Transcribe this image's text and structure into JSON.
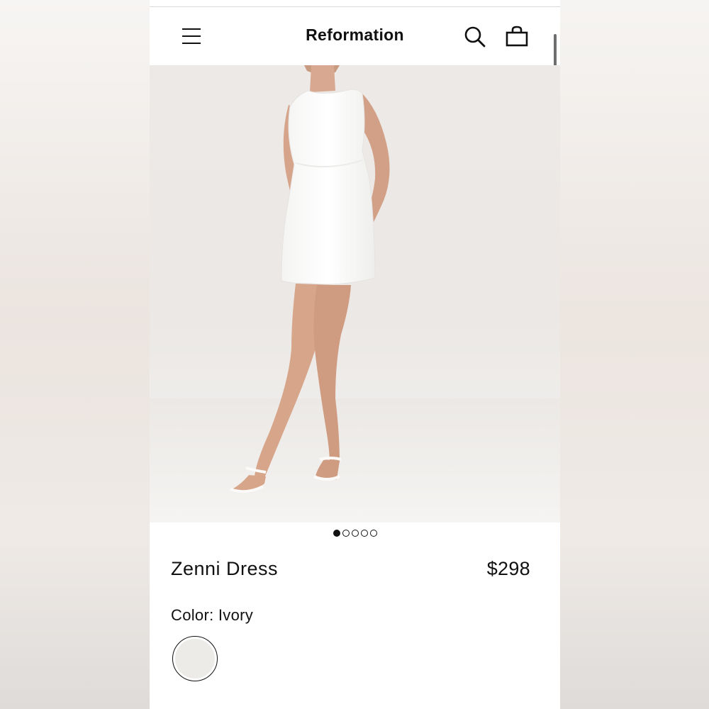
{
  "header": {
    "brand": "Reformation",
    "menu_icon": "hamburger-menu-icon",
    "search_icon": "search-icon",
    "bag_icon": "shopping-bag-icon"
  },
  "hero": {
    "image_count": 5,
    "active_index": 0
  },
  "product": {
    "name": "Zenni Dress",
    "price": "$298",
    "color_label": "Color: Ivory",
    "swatch_color": "#ecebe7"
  },
  "colors": {
    "text": "#111111",
    "dress": "#ffffff",
    "skin": "#d9a98e",
    "background": "#ebe8e5"
  }
}
